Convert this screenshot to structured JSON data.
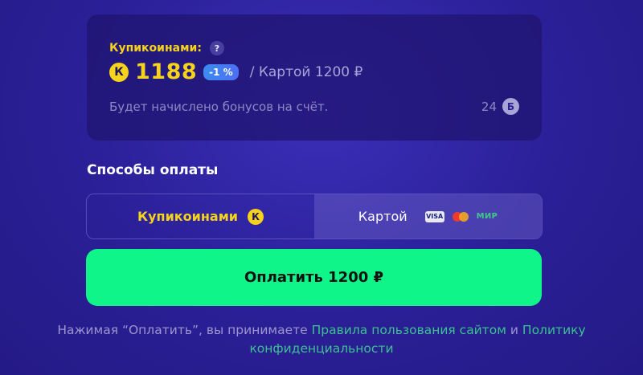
{
  "balance_card": {
    "label": "Купикоинами:",
    "help_symbol": "?",
    "coin_symbol": "К",
    "amount": "1188",
    "discount": "-1 %",
    "card_price": "/ Картой 1200 ₽",
    "bonus_text": "Будет начислено бонусов на счёт.",
    "bonus_amount": "24",
    "bonus_symbol": "Б"
  },
  "payment_methods": {
    "title": "Способы оплаты",
    "options": [
      {
        "label": "Купикоинами",
        "icon": "coin-k-icon",
        "selected": false
      },
      {
        "label": "Картой",
        "icon": "card-logos",
        "selected": true
      }
    ],
    "card_logos": {
      "visa": "VISA",
      "mir": "МИР"
    }
  },
  "pay_button": {
    "label": "Оплатить 1200 ₽"
  },
  "terms": {
    "prefix": "Нажимая “Оплатить”, вы принимаете",
    "rules_link": "Правила пользования сайтом",
    "conjunction": "и",
    "privacy_link": "Политику конфиденциальности"
  },
  "colors": {
    "background": "#2a1f96",
    "accent_yellow": "#f5d21c",
    "pay_button": "#10f58a",
    "link_green": "#3cc290"
  }
}
